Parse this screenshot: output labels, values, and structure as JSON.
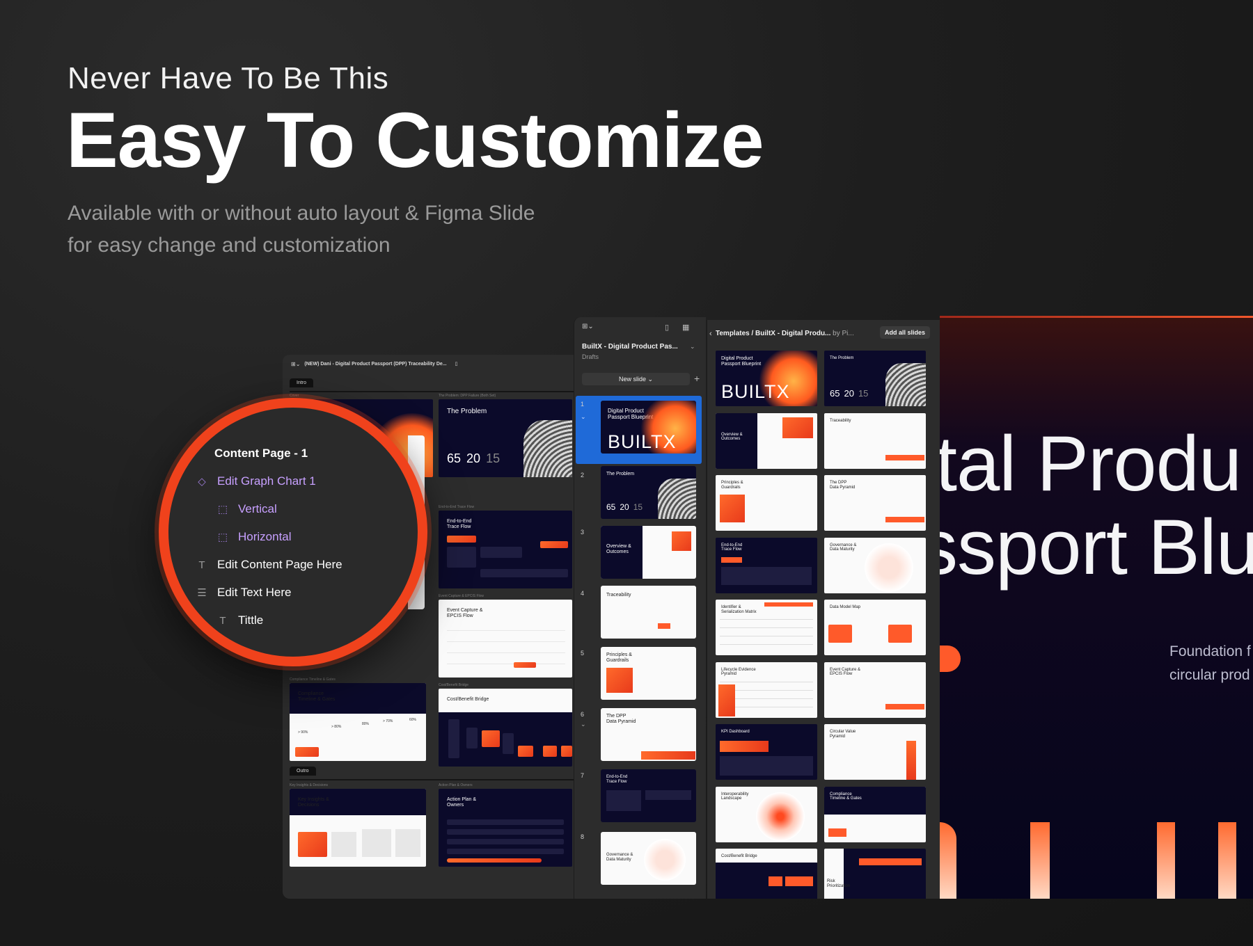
{
  "header": {
    "eyebrow": "Never Have To Be This",
    "headline": "Easy To Customize",
    "subline_1": "Available with or without auto layout  & Figma Slide",
    "subline_2": "for easy change and customization"
  },
  "panel_a": {
    "file_title": "(NEW) Dani - Digital Product Passport (DPP) Traceability De...",
    "section_intro": "Intro",
    "section_outro": "Outro",
    "label_cover": "Cover",
    "label_problem": "The Problem: DPP Failure (Both Set)",
    "label_e2e": "End-to-End Trace Flow",
    "label_event": "Event Capture & EPCIS Flow",
    "label_compliance": "Compliance Timeline & Gates",
    "label_costbenefit": "Cost/Benefit Bridge",
    "label_keyinsights": "Key Insights & Decisions",
    "label_actionplan": "Action Plan & Owners",
    "slides": {
      "problem_title": "The Problem",
      "problem_stats": [
        "65",
        "20",
        "15"
      ],
      "e2e_title": "End-to-End\nTrace Flow",
      "event_title": "Event Capture &\nEPCIS Flow",
      "compliance_title": "Compliance\nTimeline & Gates",
      "compliance_stats": [
        "> 90%",
        "> 80%",
        "80%",
        "> 70%",
        "60%"
      ],
      "costbenefit_title": "Cost/Benefit Bridge",
      "keyinsights_title": "Key Insights &\nDecisions",
      "actionplan_title": "Action Plan &\nOwners"
    }
  },
  "zoom_menu": {
    "items": [
      {
        "label": "Content Page - 1",
        "icon": "frame-icon",
        "glyph": ""
      },
      {
        "label": "Edit Graph Chart 1",
        "icon": "component-diamond-icon",
        "glyph": "◇"
      },
      {
        "label": "Vertical",
        "icon": "dashed-frame-icon",
        "glyph": "⬚"
      },
      {
        "label": "Horizontal",
        "icon": "dashed-frame-icon",
        "glyph": "⬚"
      },
      {
        "label": "Edit Content Page Here",
        "icon": "text-icon",
        "glyph": "T"
      },
      {
        "label": "Edit Text Here",
        "icon": "auto-layout-icon",
        "glyph": "☰"
      },
      {
        "label": "Tittle",
        "icon": "text-icon",
        "glyph": "T"
      }
    ],
    "ring_color": "#f0421c",
    "purple": "#c7a0ff"
  },
  "panel_b": {
    "file_name": "BuiltX - Digital Product Pas...",
    "location": "Drafts",
    "new_slide": "New slide ⌄",
    "add": "+",
    "items": [
      {
        "num": "1",
        "title": "Digital Product\nPassport Blueprint",
        "big": "BUILTX"
      },
      {
        "num": "2",
        "title": "The Problem",
        "stats": [
          "65",
          "20",
          "15"
        ]
      },
      {
        "num": "3",
        "title": "Overview &\nOutcomes"
      },
      {
        "num": "4",
        "title": "Traceability"
      },
      {
        "num": "5",
        "title": "Principles &\nGuardrails"
      },
      {
        "num": "6",
        "title": "The DPP\nData Pyramid"
      },
      {
        "num": "7",
        "title": "End-to-End\nTrace Flow"
      },
      {
        "num": "8",
        "title": "Governance &\nData Maturity"
      }
    ],
    "selected_color": "#1f6ad8"
  },
  "panel_c": {
    "breadcrumb": "Templates / BuiltX - Digital Produ...",
    "by": " by Pi...",
    "add_all": "Add all slides",
    "back_icon": "‹",
    "cells": [
      {
        "title": "Digital Product\nPassport Blueprint",
        "big": "BUILTX",
        "style": "cover"
      },
      {
        "title": "The Problem",
        "stats": [
          "65",
          "20",
          "15"
        ],
        "style": "problem"
      },
      {
        "title": "Overview &\nOutcomes",
        "style": "split"
      },
      {
        "title": "Traceability",
        "style": "light"
      },
      {
        "title": "Principles &\nGuardrails",
        "style": "split-orange"
      },
      {
        "title": "The DPP\nData Pyramid",
        "style": "light"
      },
      {
        "title": "End-to-End\nTrace Flow",
        "style": "dark"
      },
      {
        "title": "Governance &\nData Maturity",
        "style": "pyramid"
      },
      {
        "title": "Identifier &\nSerialization Matrix",
        "style": "table"
      },
      {
        "title": "Data Model Map",
        "style": "light-cards"
      },
      {
        "title": "Lifecycle Evidence\nPyramid",
        "style": "table-orange"
      },
      {
        "title": "Event Capture &\nEPCIS Flow",
        "style": "light"
      },
      {
        "title": "KPI Dashboard",
        "style": "dark-kpi"
      },
      {
        "title": "Circular Value\nPyramid",
        "style": "bars"
      },
      {
        "title": "Interoperability\nLandscape",
        "style": "radial"
      },
      {
        "title": "Compliance\nTimeline & Gates",
        "style": "split-dark"
      },
      {
        "title": "Cost/Benefit Bridge",
        "style": "dark-bars"
      },
      {
        "title": "Risk\nPrioritization",
        "style": "funnel"
      }
    ]
  },
  "hero": {
    "line1": "ital Produ",
    "line2": "ssport Blu",
    "foundation_1": "Foundation f",
    "foundation_2": "circular prod",
    "bg": "#06051d",
    "accent": "#ff5a2a"
  }
}
